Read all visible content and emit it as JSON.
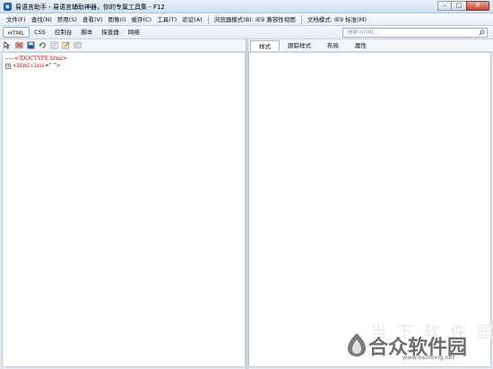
{
  "window": {
    "title": "易语言助手 - 易语言辅助神器，你的专属工具集 - F12",
    "controls": {
      "minimize": "–",
      "maximize": "□",
      "close": "✕"
    }
  },
  "menu": {
    "items": [
      {
        "id": "file",
        "label": "文件(F)"
      },
      {
        "id": "find",
        "label": "查找(N)"
      },
      {
        "id": "disable",
        "label": "禁用(S)"
      },
      {
        "id": "view",
        "label": "查看(V)"
      },
      {
        "id": "image",
        "label": "图像(I)"
      },
      {
        "id": "cache",
        "label": "缓存(C)"
      },
      {
        "id": "tools",
        "label": "工具(T)"
      },
      {
        "id": "validate",
        "label": "验证(A)"
      }
    ],
    "browser_mode": "浏览器模式(B): IE9 兼容性视图",
    "document_mode": "文档模式: IE9 标准(M)"
  },
  "tabs": [
    {
      "id": "html",
      "label": "HTML",
      "active": true
    },
    {
      "id": "css",
      "label": "CSS",
      "active": false
    },
    {
      "id": "console",
      "label": "控制台",
      "active": false
    },
    {
      "id": "script",
      "label": "脚本",
      "active": false
    },
    {
      "id": "profiler",
      "label": "探查器",
      "active": false
    },
    {
      "id": "network",
      "label": "网络",
      "active": false
    }
  ],
  "search": {
    "placeholder": "搜索 HTML..."
  },
  "toolbar_icons": [
    "select-element-icon",
    "clear-browser-cache-icon",
    "save-icon",
    "refresh-icon",
    "word-wrap-icon",
    "edit-icon",
    "attributes-icon"
  ],
  "dom_tree": {
    "doctype": "<!DOCTYPE html>",
    "html_tag_open": "<html",
    "html_attr_name": "class",
    "html_attr_value": "\" \"",
    "html_tag_close": ">",
    "expander": "+"
  },
  "right_tabs": [
    {
      "id": "style",
      "label": "样式",
      "active": true
    },
    {
      "id": "trace-styles",
      "label": "跟踪样式",
      "active": false
    },
    {
      "id": "layout",
      "label": "布局",
      "active": false
    },
    {
      "id": "attributes",
      "label": "属性",
      "active": false
    }
  ],
  "watermark": {
    "ghost_text": "当 下 软 件 园",
    "brand": "合众软件园",
    "url": "www.hezhong.net"
  },
  "colors": {
    "active_tab_border": "#8aa4c2",
    "close_button": "#c34a36",
    "dom_tag": "#a31515",
    "dom_value": "#1a1aa6"
  }
}
